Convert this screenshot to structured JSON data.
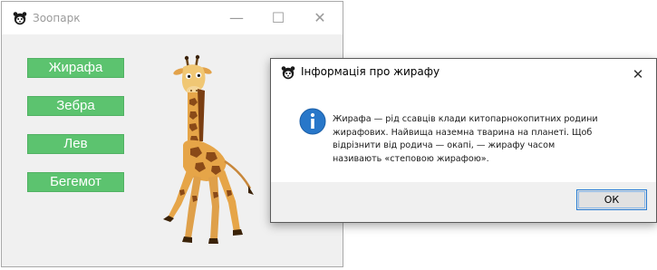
{
  "main_window": {
    "title": "Зоопарк",
    "controls": {
      "minimize": "—",
      "maximize": "☐",
      "close": "✕"
    },
    "animal_buttons": [
      {
        "label": "Жирафа"
      },
      {
        "label": "Зебра"
      },
      {
        "label": "Лев"
      },
      {
        "label": "Бегемот"
      }
    ],
    "button_color": "#5cc36f"
  },
  "dialog": {
    "title": "Інформація про жирафу",
    "close": "✕",
    "message_lines": [
      "Жирафа — рід ссавців клади китопарнокопитних родини",
      "жирафових. Найвища наземна тварина на планеті. Щоб",
      "відрізнити від родича — окапі, — жирафу часом",
      "називають «степовою жирафою»."
    ],
    "ok_label": "ОК",
    "icon": "information-icon",
    "icon_color": "#2877c9"
  }
}
